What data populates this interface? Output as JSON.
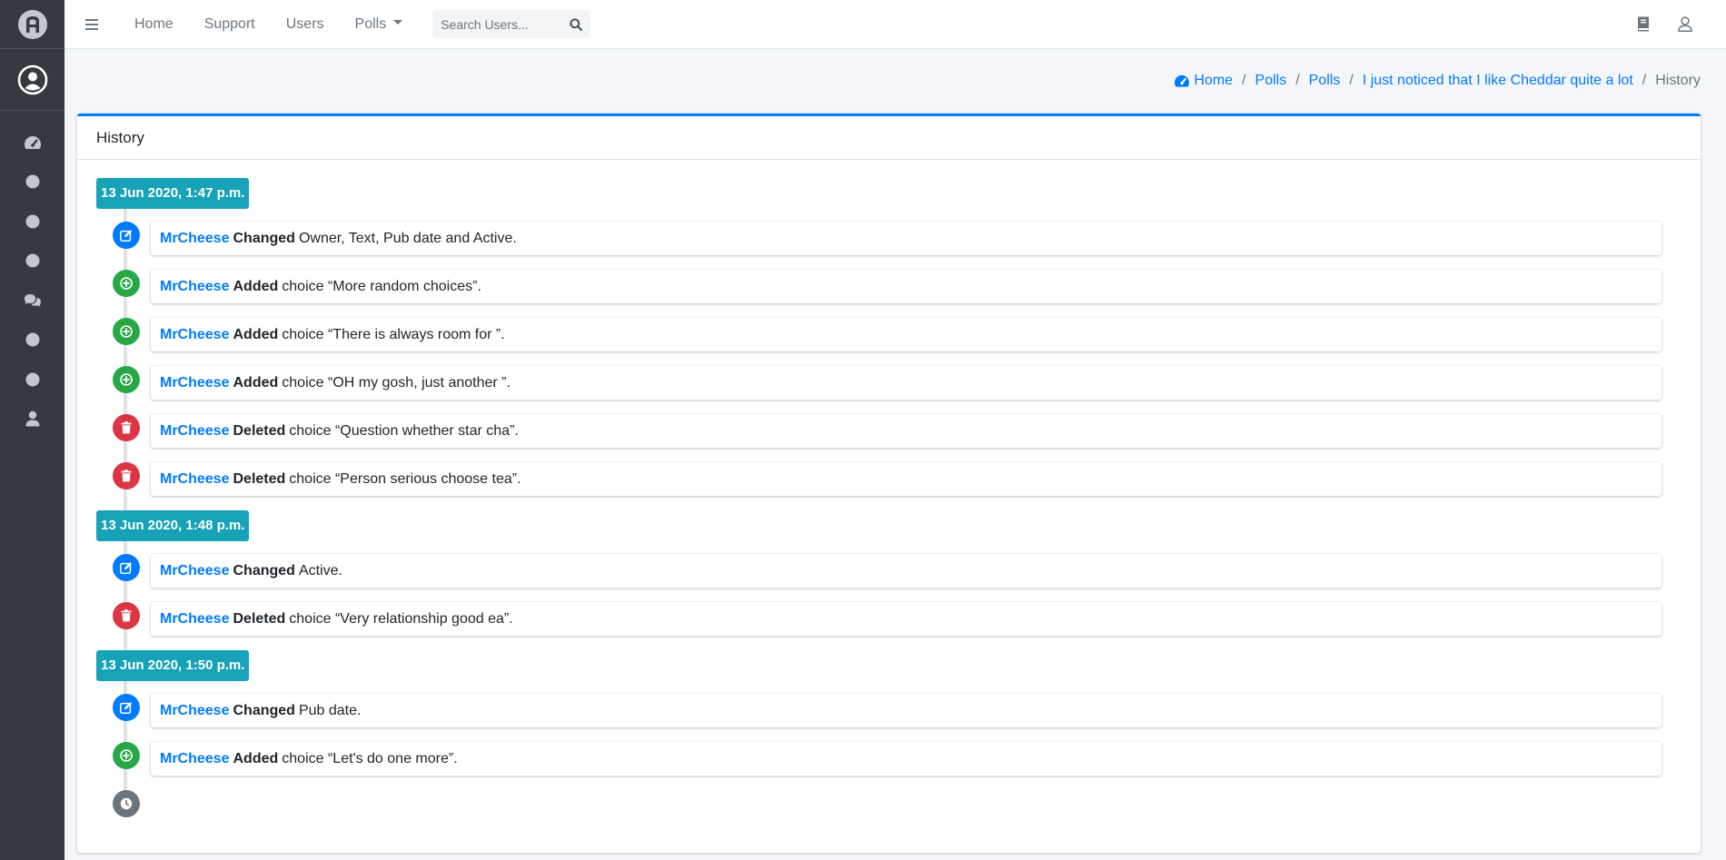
{
  "topbar": {
    "nav": [
      "Home",
      "Support",
      "Users"
    ],
    "polls_label": "Polls",
    "search_placeholder": "Search Users..."
  },
  "breadcrumb": {
    "home": "Home",
    "polls_1": "Polls",
    "polls_2": "Polls",
    "poll": "I just noticed that I like Cheddar quite a lot",
    "current": "History",
    "separator": "/"
  },
  "card": {
    "title": "History"
  },
  "timeline": {
    "groups": [
      {
        "label": "13 Jun 2020, 1:47 p.m.",
        "entries": [
          {
            "user": "MrCheese",
            "action": "Changed",
            "detail": "Owner, Text, Pub date and Active.",
            "icon": "edit-icon",
            "color": "#007bff"
          },
          {
            "user": "MrCheese",
            "action": "Added",
            "detail": "choice “More random choices”.",
            "icon": "plus-circle-icon",
            "color": "#28a745"
          },
          {
            "user": "MrCheese",
            "action": "Added",
            "detail": "choice “There is always room for ”.",
            "icon": "plus-circle-icon",
            "color": "#28a745"
          },
          {
            "user": "MrCheese",
            "action": "Added",
            "detail": "choice “OH my gosh, just another ”.",
            "icon": "plus-circle-icon",
            "color": "#28a745"
          },
          {
            "user": "MrCheese",
            "action": "Deleted",
            "detail": "choice “Question whether star cha”.",
            "icon": "trash-icon",
            "color": "#dc3545"
          },
          {
            "user": "MrCheese",
            "action": "Deleted",
            "detail": "choice “Person serious choose tea”.",
            "icon": "trash-icon",
            "color": "#dc3545"
          }
        ]
      },
      {
        "label": "13 Jun 2020, 1:48 p.m.",
        "entries": [
          {
            "user": "MrCheese",
            "action": "Changed",
            "detail": "Active.",
            "icon": "edit-icon",
            "color": "#007bff"
          },
          {
            "user": "MrCheese",
            "action": "Deleted",
            "detail": "choice “Very relationship good ea”.",
            "icon": "trash-icon",
            "color": "#dc3545"
          }
        ]
      },
      {
        "label": "13 Jun 2020, 1:50 p.m.",
        "entries": [
          {
            "user": "MrCheese",
            "action": "Changed",
            "detail": "Pub date.",
            "icon": "edit-icon",
            "color": "#007bff"
          },
          {
            "user": "MrCheese",
            "action": "Added",
            "detail": "choice “Let's do one more”.",
            "icon": "plus-circle-icon",
            "color": "#28a745"
          }
        ]
      }
    ],
    "end_icon": "clock-icon"
  },
  "colors": {
    "sidebar": "#343a40",
    "accent": "#007bff",
    "time_label": "#17a2b8",
    "added": "#28a745",
    "deleted": "#dc3545",
    "end": "#6c757d"
  }
}
